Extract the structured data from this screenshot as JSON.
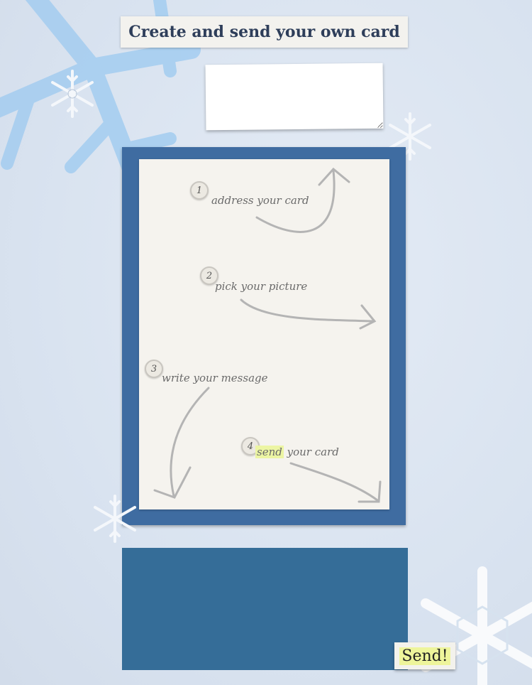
{
  "title": "Create and send your own card",
  "steps": [
    {
      "number": "1",
      "label": "address your card"
    },
    {
      "number": "2",
      "label": "pick your picture"
    },
    {
      "number": "3",
      "label": "write your message"
    },
    {
      "number": "4",
      "label_highlight": "send",
      "label_rest": " your card"
    }
  ],
  "send_button": "Send!",
  "colors": {
    "background": "#dbe4f0",
    "card_frame": "#3f6ca1",
    "message_box": "#356d98",
    "highlight": "#ecf5a3"
  },
  "icons": [
    "snowflake-icon",
    "arrow-icon"
  ]
}
